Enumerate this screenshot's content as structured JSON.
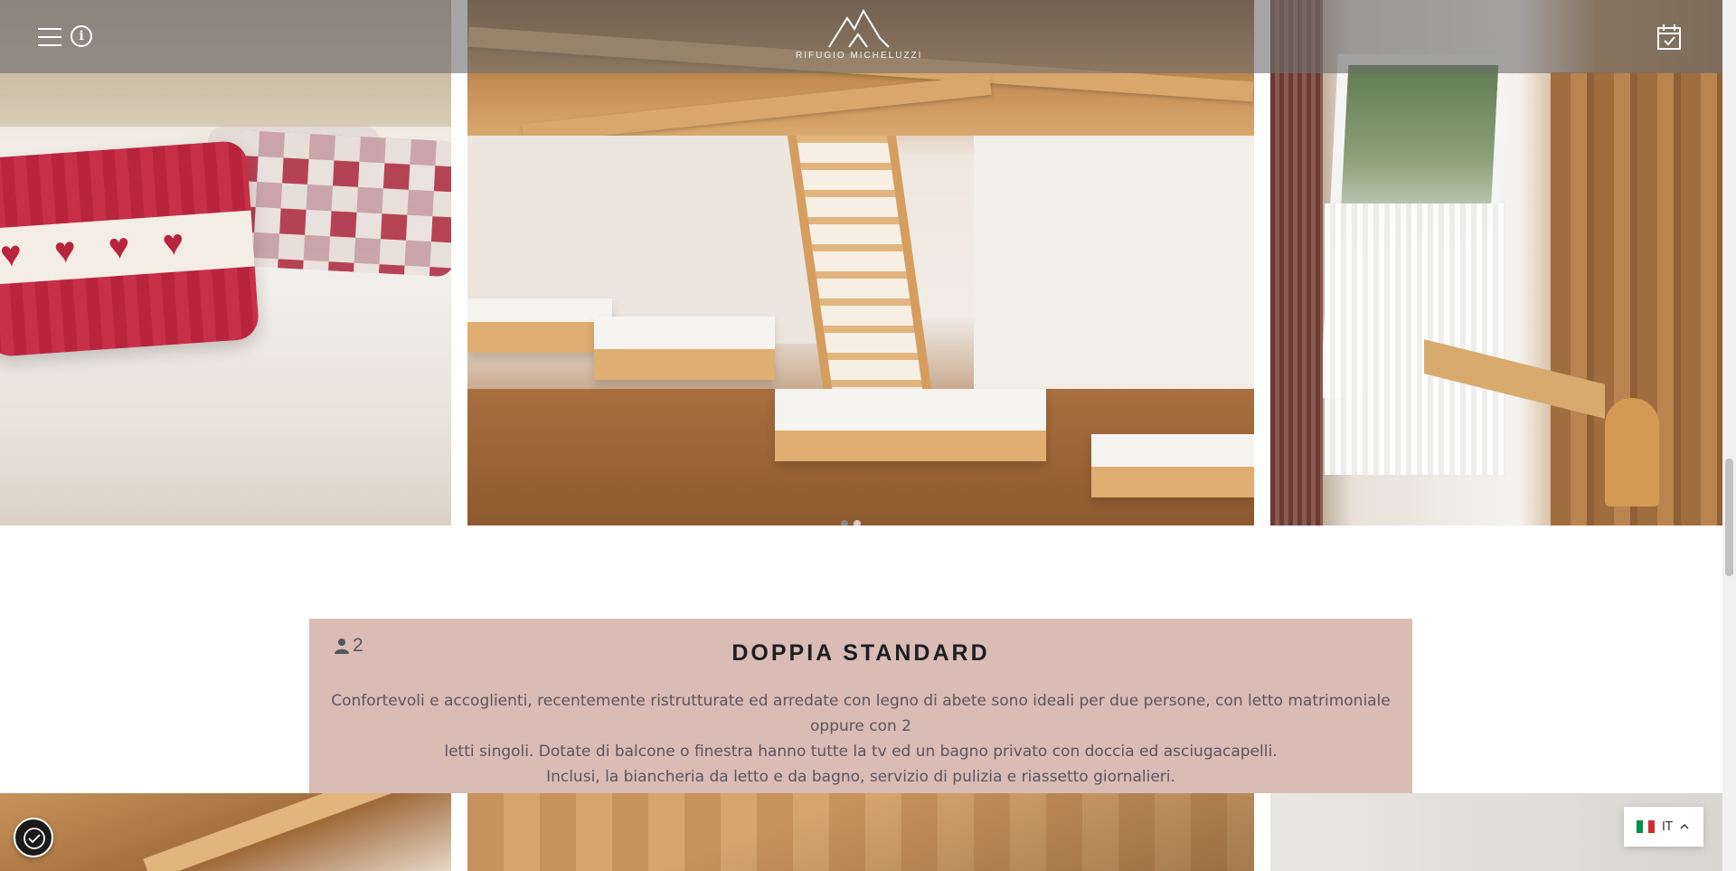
{
  "header": {
    "logo_text": "RIFUGIO MICHELUZZI",
    "menu_icon": "hamburger-icon",
    "info_icon": "info-icon",
    "info_glyph": "i",
    "booking_icon": "calendar-check-icon"
  },
  "gallery_top": {
    "slides_total": 2,
    "active_slide": 1
  },
  "room": {
    "guests": "2",
    "guests_icon": "person-icon",
    "title": "DOPPIA STANDARD",
    "description_line1": "Confortevoli e accoglienti, recentemente ristrutturate ed arredate con legno di abete sono ideali per due persone, con letto matrimoniale oppure con 2",
    "description_line2": "letti singoli. Dotate di balcone o finestra hanno tutte la tv ed un bagno privato con doccia ed asciugacapelli.",
    "description_line3": "Inclusi, la biancheria da letto e da bagno, servizio di pulizia e riassetto giornalieri."
  },
  "language": {
    "code": "IT",
    "flag_colors": [
      "#009246",
      "#ffffff",
      "#ce2b37"
    ]
  },
  "colors": {
    "card_bg": "#d9bcb4",
    "header_overlay": "rgba(110,110,110,0.62)"
  },
  "cookie": {
    "icon": "cookie-consent-icon"
  }
}
